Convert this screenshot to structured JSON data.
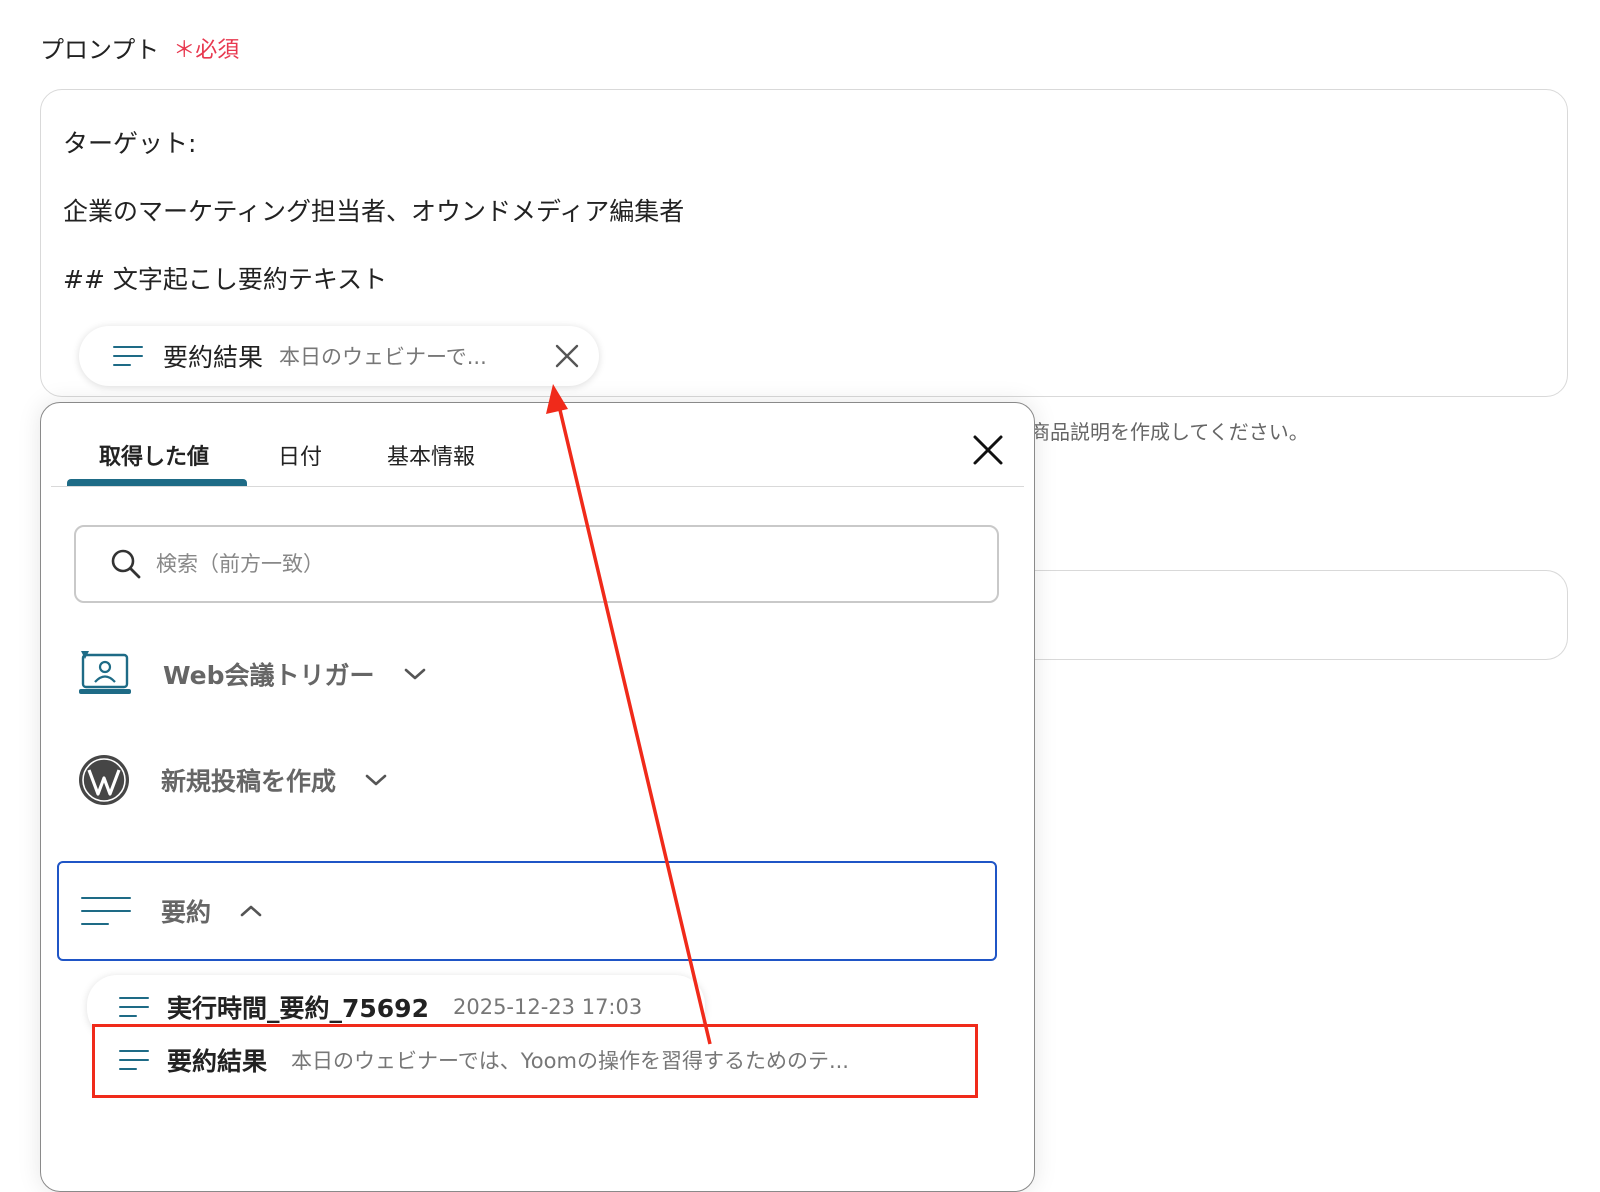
{
  "field": {
    "label": "プロンプト",
    "required": "＊必須"
  },
  "prompt": {
    "lines": [
      "ターゲット:",
      "企業のマーケティング担当者、オウンドメディア編集者",
      "## 文字起こし要約テキスト"
    ],
    "chip": {
      "title": "要約結果",
      "preview": "本日のウェビナーで..."
    }
  },
  "hint_text": "商品説明を作成してください。",
  "panel": {
    "tabs": [
      {
        "label": "取得した値",
        "active": true
      },
      {
        "label": "日付",
        "active": false
      },
      {
        "label": "基本情報",
        "active": false
      }
    ],
    "search": {
      "placeholder": "検索（前方一致）",
      "value": ""
    },
    "groups": [
      {
        "label": "Web会議トリガー",
        "icon": "web-meeting-icon",
        "expanded": false
      },
      {
        "label": "新規投稿を作成",
        "icon": "wordpress-icon",
        "expanded": false
      },
      {
        "label": "要約",
        "icon": "text-lines-icon",
        "expanded": true
      }
    ],
    "items": [
      {
        "title": "実行時間_要約_75692",
        "value": "2025-12-23 17:03"
      },
      {
        "title": "要約結果",
        "value": "本日のウェビナーでは、Yoomの操作を習得するためのテ..."
      }
    ]
  },
  "colors": {
    "accent": "#1e6b86",
    "focus_border": "#1f55c6",
    "annotation_red": "#f02a1a",
    "required_red": "#e8384f"
  }
}
